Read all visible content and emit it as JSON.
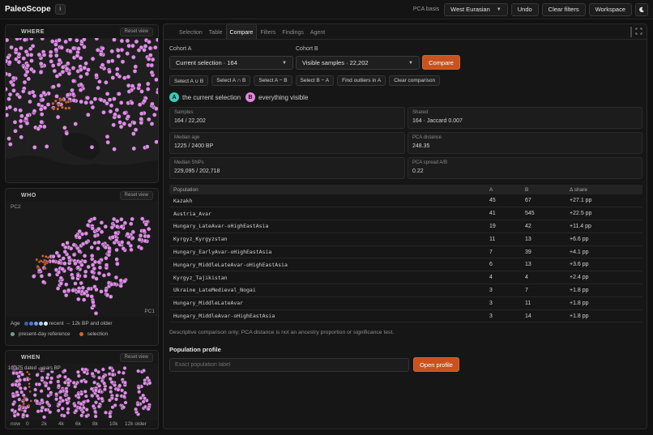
{
  "app": {
    "title": "PaleoScope",
    "info_icon": "i"
  },
  "topbar": {
    "pca_label": "PCA basis",
    "pca_value": "West Eurasian",
    "undo": "Undo",
    "clear_filters": "Clear filters",
    "workspace": "Workspace",
    "theme_icon": "moon-icon"
  },
  "panels": {
    "where": {
      "title": "WHERE",
      "reset": "Reset view"
    },
    "who": {
      "title": "WHO",
      "reset": "Reset view",
      "pc2": "PC2",
      "pc1": "PC1",
      "age_label": "Age",
      "age_range": "recent → 12k BP and older",
      "legend_reference": "present-day reference",
      "legend_selection": "selection"
    },
    "when": {
      "title": "WHEN",
      "reset": "Reset view",
      "dated_note": "10,175 dated · years BP",
      "ticks": [
        "now",
        "0",
        "2k",
        "4k",
        "6k",
        "8k",
        "10k",
        "12k older"
      ]
    }
  },
  "tabs": [
    "Selection",
    "Table",
    "Compare",
    "Filters",
    "Findings",
    "Agent"
  ],
  "active_tab": "Compare",
  "compare": {
    "cohort_a_label": "Cohort A",
    "cohort_a_value": "Current selection · 164",
    "cohort_b_label": "Cohort B",
    "cohort_b_value": "Visible samples · 22,202",
    "compare_button": "Compare",
    "actions": [
      "Select A ∪ B",
      "Select A ∩ B",
      "Select A − B",
      "Select B − A",
      "Find outliers in A",
      "Clear comparison"
    ],
    "a_badge": "A",
    "a_text": "the current selection",
    "b_badge": "B",
    "b_text": "everything visible",
    "stats": [
      {
        "k": "Samples",
        "v": "164 / 22,202"
      },
      {
        "k": "Shared",
        "v": "164 · Jaccard 0.007"
      },
      {
        "k": "Median age",
        "v": "1225 / 2400 BP"
      },
      {
        "k": "PCA distance",
        "v": "248.35"
      },
      {
        "k": "Median SNPs",
        "v": "229,095 / 202,718"
      },
      {
        "k": "PCA spread A/B",
        "v": "0.22"
      }
    ],
    "table_headers": [
      "Population",
      "A",
      "B",
      "Δ share"
    ],
    "rows": [
      [
        "Kazakh",
        "45",
        "67",
        "+27.1 pp"
      ],
      [
        "Austria_Avar",
        "41",
        "545",
        "+22.5 pp"
      ],
      [
        "Hungary_LateAvar-oHighEastAsia",
        "19",
        "42",
        "+11.4 pp"
      ],
      [
        "Kyrgyz_Kyrgyzstan",
        "11",
        "13",
        "+6.6 pp"
      ],
      [
        "Hungary_EarlyAvar-oHighEastAsia",
        "7",
        "39",
        "+4.1 pp"
      ],
      [
        "Hungary_MiddleLateAvar-oHighEastAsia",
        "6",
        "13",
        "+3.6 pp"
      ],
      [
        "Kyrgyz_Tajikistan",
        "4",
        "4",
        "+2.4 pp"
      ],
      [
        "Ukraine_LateMedieval_Nogai",
        "3",
        "7",
        "+1.8 pp"
      ],
      [
        "Hungary_MiddleLateAvar",
        "3",
        "11",
        "+1.8 pp"
      ],
      [
        "Hungary_MiddleAvar-oHighEastAsia",
        "3",
        "14",
        "+1.8 pp"
      ]
    ],
    "note": "Descriptive comparison only; PCA distance is not an ancestry proportion or significance test.",
    "profile_title": "Population profile",
    "profile_placeholder": "Exact population label",
    "open_profile": "Open profile"
  },
  "colors": {
    "accent": "#c9521f",
    "sample": "#e08ce8",
    "selection": "#d9632a",
    "badge_a": "#3ec9b4",
    "badge_b": "#e784e0"
  }
}
